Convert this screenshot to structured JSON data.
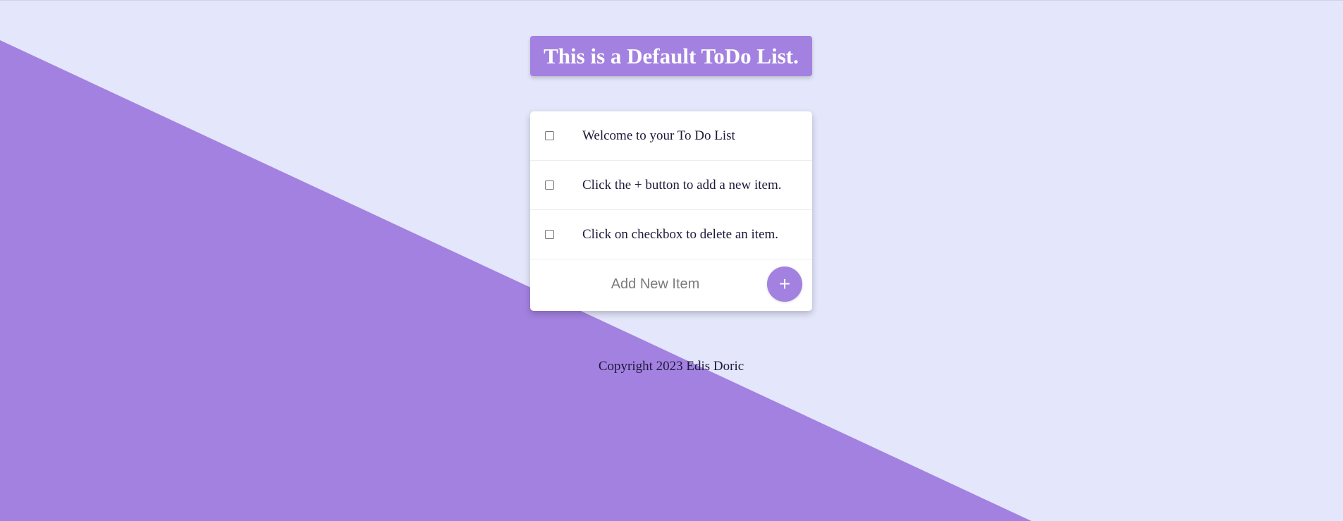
{
  "colors": {
    "background": "#e4e6fb",
    "accent": "#a381e0",
    "card": "#ffffff",
    "text": "#1d1a3a"
  },
  "header": {
    "title": "This is a Default ToDo List."
  },
  "todo": {
    "items": [
      {
        "label": "Welcome to your To Do List",
        "checked": false
      },
      {
        "label": "Click the + button to add a new item.",
        "checked": false
      },
      {
        "label": "Click on checkbox to delete an item.",
        "checked": false
      }
    ],
    "new_item": {
      "placeholder": "Add New Item",
      "value": ""
    },
    "add_button_label": "+",
    "add_button_icon": "plus-icon"
  },
  "footer": {
    "copyright": "Copyright 2023 Edis Doric"
  }
}
